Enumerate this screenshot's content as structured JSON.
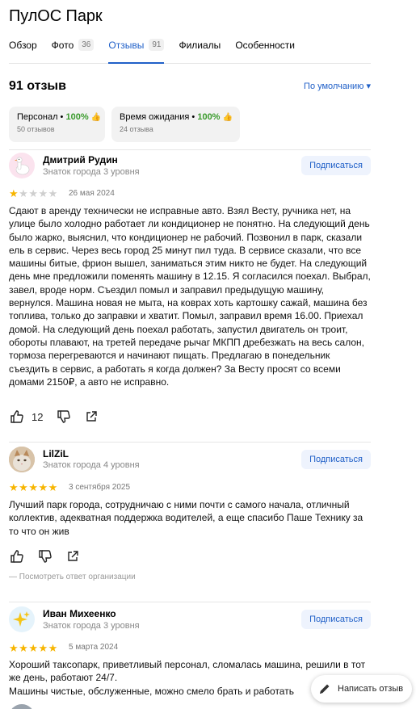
{
  "header": {
    "title": "ПулОС Парк"
  },
  "tabs": [
    {
      "label": "Обзор",
      "count": ""
    },
    {
      "label": "Фото",
      "count": "36"
    },
    {
      "label": "Отзывы",
      "count": "91"
    },
    {
      "label": "Филиалы",
      "count": ""
    },
    {
      "label": "Особенности",
      "count": ""
    }
  ],
  "reviews_header": {
    "count": "91 отзыв",
    "sort": "По умолчанию ▾"
  },
  "chips": [
    {
      "label": "Персонал •",
      "pct": "100%",
      "sub": "50 отзывов"
    },
    {
      "label": "Время ожидания •",
      "pct": "100%",
      "sub": "24 отзыва"
    }
  ],
  "subscribe_label": "Подписаться",
  "reviews": [
    {
      "name": "Дмитрий Рудин",
      "level": "Знаток города 3 уровня",
      "rating": 1,
      "date": "26 мая 2024",
      "text": "Сдают в аренду технически не исправные авто. Взял Весту, ручника нет, на улице было холодно работает ли кондиционер не понятно. На следующий день было жарко, выяснил, что кондиционер не рабочий. Позвонил в парк, сказали ель в сервис. Через весь город 25 минут пил туда. В сервисе сказали, что все машины битые, фрион вышел, заниматься этим никто не будет. На следующий день мне предложили поменять машину в 12.15. Я согласился поехал. Выбрал, завел, вроде норм. Съездил помыл и заправил предыдущую машину, вернулся. Машина новая не мыта, на коврах хоть картошку сажай, машина без топлива, только до заправки и хватит. Помыл, заправил время 16.00. Приехал домой. На следующий день поехал работать, запустил двигатель он троит, обороты плавают, на третей передаче рычаг МКПП дребезжать на весь салон, тормоза перегреваются и начинают пищать. Предлагаю в понедельник съездить в сервис, а работать я когда должен? За Весту просят со всеми домами 2150₽, а авто не исправно.",
      "likes": "12"
    },
    {
      "name": "LilZiL",
      "level": "Знаток города 4 уровня",
      "rating": 5,
      "date": "3 сентября 2025",
      "text": "Лучший парк города, сотрудничаю с ними почти с самого начала, отличный коллектив, адекватная поддержка водителей, а еще спасибо Паше Технику за то что он жив",
      "likes": "",
      "note": "— Посмотреть ответ организации"
    },
    {
      "name": "Иван Михеенко",
      "level": "Знаток города 3 уровня",
      "rating": 5,
      "date": "5 марта 2024",
      "text": "Хороший таксопарк, приветливый персонал, сломалась машина, решили в тот же день, работают 24/7.\nМашины чистые, обслуженные, можно смело брать и работать",
      "likes": ""
    }
  ],
  "fab": {
    "label": "Написать отзыв"
  },
  "colors": {
    "accent": "#2060c8",
    "star": "#f7b500",
    "star_empty": "#cfcfcf",
    "ok": "#3a9b2c"
  },
  "icons": [
    "thumb-up-icon",
    "thumb-down-icon",
    "share-icon",
    "pencil-icon",
    "chevron-down-icon"
  ]
}
